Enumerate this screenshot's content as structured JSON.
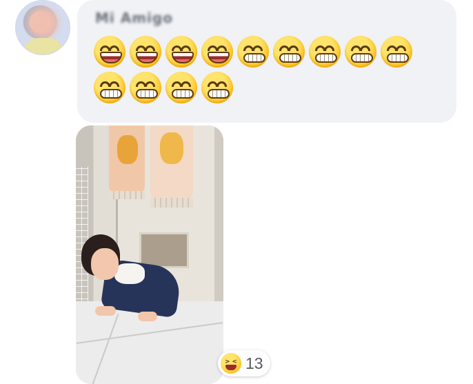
{
  "message": {
    "sender_name": "Mi Amigo",
    "emojis": [
      "laughing-face",
      "laughing-face",
      "laughing-face",
      "laughing-face",
      "grinning-face",
      "grinning-face",
      "grinning-face",
      "grinning-face",
      "grinning-face",
      "grinning-face",
      "grinning-face",
      "grinning-face",
      "grinning-face"
    ]
  },
  "reaction": {
    "icon": "laughing-squint-face-icon",
    "count": "13"
  },
  "colors": {
    "bubble_bg": "#f0f2f5",
    "emoji_yellow": "#fcc21b"
  }
}
